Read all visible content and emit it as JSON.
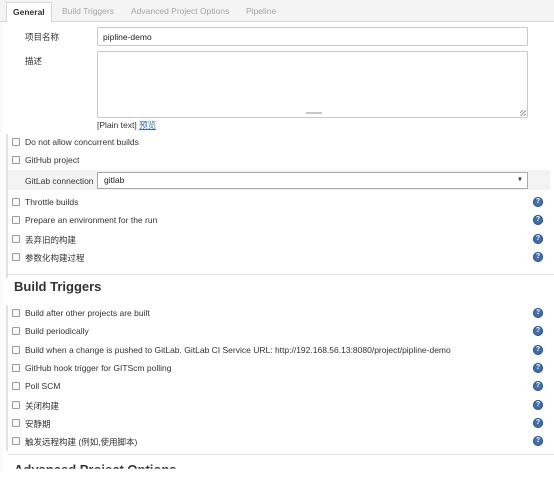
{
  "tabs": [
    {
      "label": "General",
      "active": true
    },
    {
      "label": "Build Triggers",
      "active": false
    },
    {
      "label": "Advanced Project Options",
      "active": false
    },
    {
      "label": "Pipeline",
      "active": false
    }
  ],
  "general": {
    "project_name_label": "项目名称",
    "project_name_value": "pipline-demo",
    "description_label": "描述",
    "description_value": "",
    "plain_text_prefix": "[Plain text]",
    "preview_link": "预览",
    "options": [
      {
        "label": "Do not allow concurrent builds",
        "checked": false,
        "help": false
      },
      {
        "label": "GitHub project",
        "checked": false,
        "help": false
      }
    ],
    "gitlab_connection_label": "GitLab connection",
    "gitlab_connection_value": "gitlab",
    "options2": [
      {
        "label": "Throttle builds",
        "checked": false,
        "help": true
      },
      {
        "label": "Prepare an environment for the run",
        "checked": false,
        "help": true
      },
      {
        "label": "丢弃旧的构建",
        "checked": false,
        "help": true
      },
      {
        "label": "参数化构建过程",
        "checked": false,
        "help": true
      }
    ]
  },
  "build_triggers": {
    "heading": "Build Triggers",
    "options": [
      {
        "label": "Build after other projects are built",
        "checked": false,
        "help": true
      },
      {
        "label": "Build periodically",
        "checked": false,
        "help": true
      },
      {
        "label": "Build when a change is pushed to GitLab. GitLab CI Service URL: http://192.168.56.13:8080/project/pipline-demo",
        "checked": false,
        "help": true
      },
      {
        "label": "GitHub hook trigger for GITScm polling",
        "checked": false,
        "help": true
      },
      {
        "label": "Poll SCM",
        "checked": false,
        "help": true
      },
      {
        "label": "关闭构建",
        "checked": false,
        "help": true
      },
      {
        "label": "安静期",
        "checked": false,
        "help": true
      },
      {
        "label": "触发远程构建 (例如,使用脚本)",
        "checked": false,
        "help": true
      }
    ]
  },
  "next_section_heading": "Advanced Project Options",
  "help_glyph": "?",
  "select_arrow": "▼"
}
